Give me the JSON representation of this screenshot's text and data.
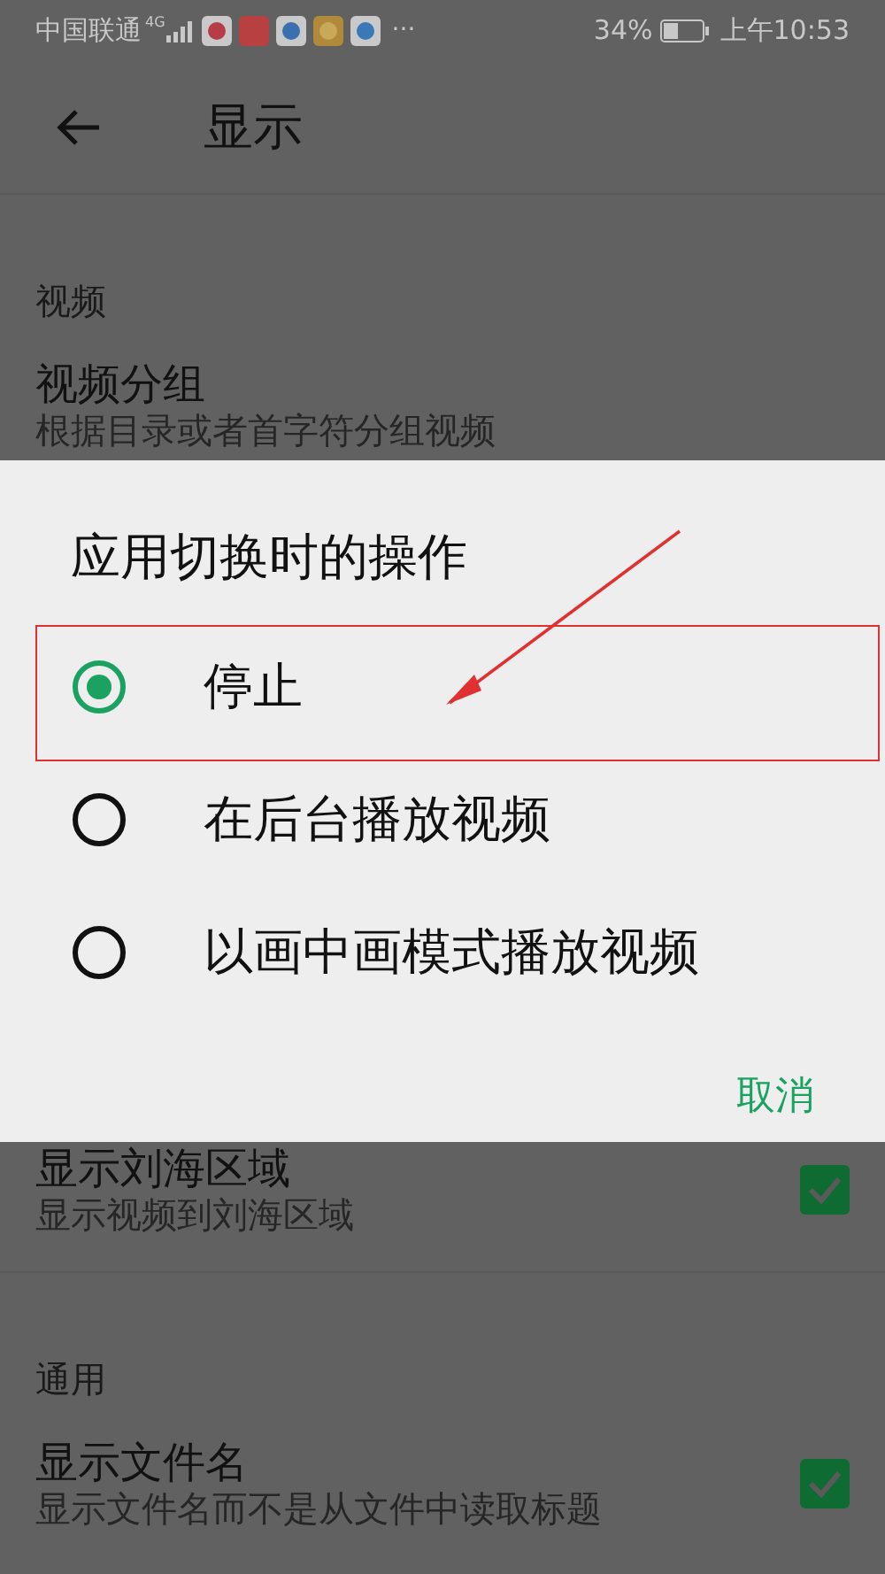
{
  "status_bar": {
    "carrier": "中国联通",
    "network": "4G",
    "more": "···",
    "battery": "34%",
    "time": "上午10:53"
  },
  "toolbar": {
    "title": "显示"
  },
  "sections": [
    {
      "header": "视频",
      "items": [
        {
          "kind": "plain",
          "title": "视频分组",
          "subtitle": "根据目录或者首字符分组视频"
        },
        {
          "kind": "checkbox",
          "title": "显示刘海区域",
          "subtitle": "显示视频到刘海区域",
          "checked": true
        }
      ]
    },
    {
      "header": "通用",
      "items": [
        {
          "kind": "checkbox",
          "title": "显示文件名",
          "subtitle": "显示文件名而不是从文件中读取标题",
          "checked": true
        }
      ]
    }
  ],
  "dialog": {
    "title": "应用切换时的操作",
    "options": [
      {
        "label": "停止",
        "selected": true
      },
      {
        "label": "在后台播放视频",
        "selected": false
      },
      {
        "label": "以画中画模式播放视频",
        "selected": false
      }
    ],
    "button": "取消"
  }
}
